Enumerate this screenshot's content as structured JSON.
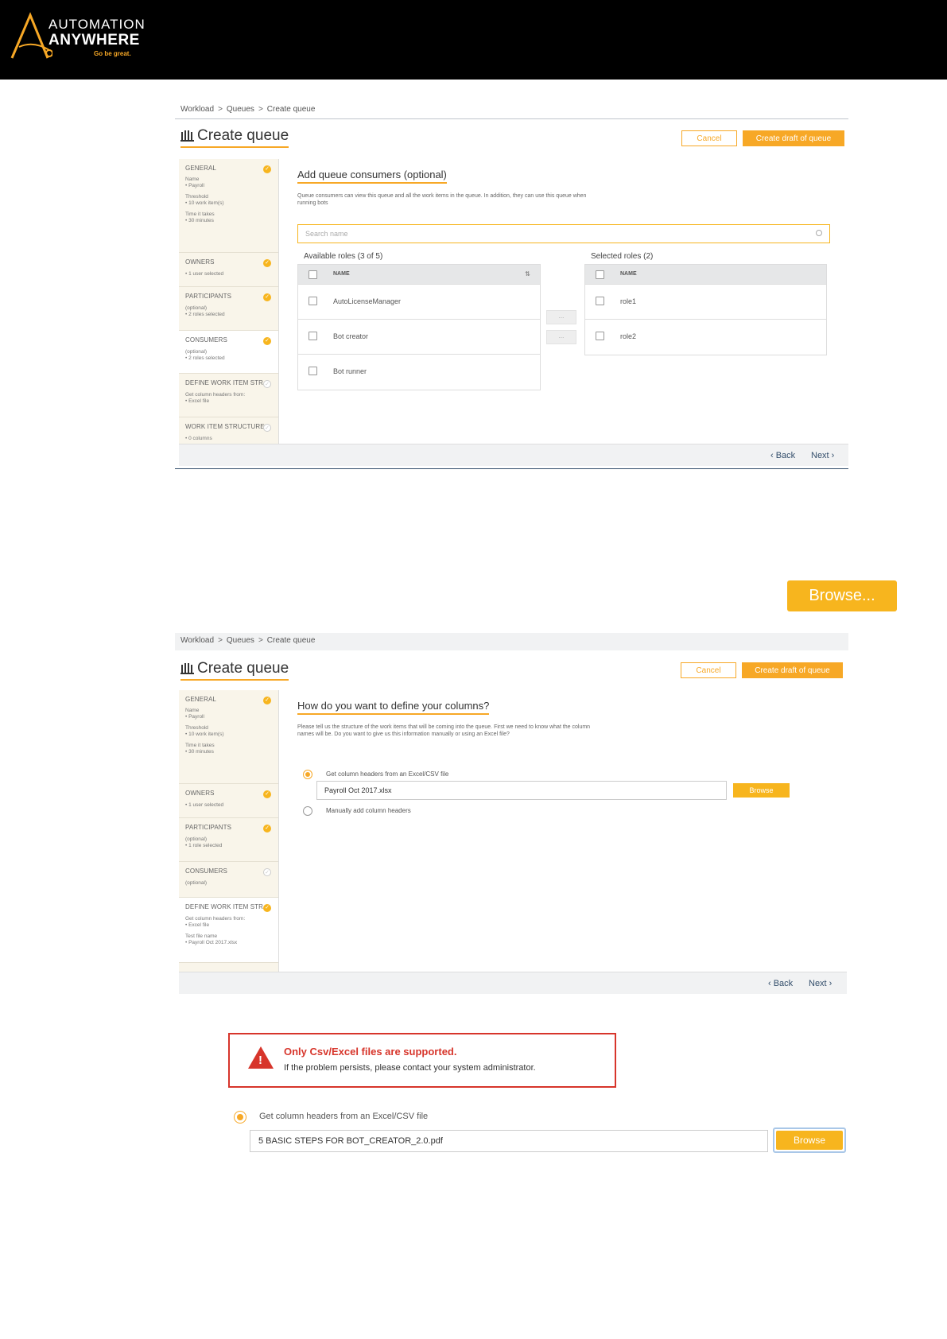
{
  "brand": {
    "line1": "AUTOMATION",
    "line2": "ANYWHERE",
    "tagline": "Go be great."
  },
  "colors": {
    "accent": "#f7a826",
    "error": "#d7352b",
    "header_bg": "#000000",
    "link": "#334e6b"
  },
  "shot1": {
    "breadcrumb": [
      "Workload",
      "Queues",
      "Create queue"
    ],
    "title": "Create queue",
    "cancel": "Cancel",
    "create_draft": "Create draft of queue",
    "sidebar": {
      "general": {
        "head": "GENERAL",
        "name_label": "Name",
        "name_value": "• Payroll",
        "threshold_label": "Threshold",
        "threshold_value": "• 10 work item(s)",
        "time_label": "Time it takes",
        "time_value": "• 30 minutes"
      },
      "owners": {
        "head": "OWNERS",
        "value": "• 1 user selected"
      },
      "participants": {
        "head": "PARTICIPANTS",
        "opt": "(optional)",
        "value": "• 2 roles selected"
      },
      "consumers": {
        "head": "CONSUMERS",
        "opt": "(optional)",
        "value": "• 2 roles selected"
      },
      "define": {
        "head": "DEFINE WORK ITEM STR...",
        "label": "Get column headers from:",
        "value": "• Excel file"
      },
      "structure": {
        "head": "WORK ITEM STRUCTURE",
        "value": "• 0 columns"
      }
    },
    "main": {
      "heading": "Add queue consumers (optional)",
      "desc": "Queue consumers can view this queue and all the work items in the queue. In addition, they can use this queue when running bots",
      "search_placeholder": "Search name",
      "available_label": "Available roles (3 of 5)",
      "selected_label": "Selected roles (2)",
      "col_name": "NAME",
      "available": [
        "AutoLicenseManager",
        "Bot creator",
        "Bot runner"
      ],
      "selected": [
        "role1",
        "role2"
      ],
      "move_right": "...",
      "move_left": "..."
    },
    "back": "‹ Back",
    "next": "Next ›"
  },
  "browse_big": "Browse...",
  "shot2": {
    "breadcrumb": [
      "Workload",
      "Queues",
      "Create queue"
    ],
    "title": "Create queue",
    "cancel": "Cancel",
    "create_draft": "Create draft of queue",
    "sidebar": {
      "general": {
        "head": "GENERAL",
        "name_label": "Name",
        "name_value": "• Payroll",
        "threshold_label": "Threshold",
        "threshold_value": "• 10 work item(s)",
        "time_label": "Time it takes",
        "time_value": "• 30 minutes"
      },
      "owners": {
        "head": "OWNERS",
        "value": "• 1 user selected"
      },
      "participants": {
        "head": "PARTICIPANTS",
        "opt": "(optional)",
        "value": "• 1 role selected"
      },
      "consumers": {
        "head": "CONSUMERS",
        "opt": "(optional)"
      },
      "define": {
        "head": "DEFINE WORK ITEM STR...",
        "label": "Get column headers from:",
        "value": "• Excel file",
        "file_label": "Test file name",
        "file_value": "• Payroll Oct 2017.xlsx"
      }
    },
    "main": {
      "heading": "How do you want to define your columns?",
      "desc": "Please tell us the structure of the work items that will be coming into the queue. First we need to know what the column names will be. Do you want to give us this information manually or using an Excel file?",
      "opt1": "Get column headers from an Excel/CSV file",
      "file_value": "Payroll Oct 2017.xlsx",
      "browse": "Browse",
      "opt2": "Manually add column headers"
    },
    "back": "‹ Back",
    "next": "Next ›"
  },
  "error": {
    "title": "Only Csv/Excel files are supported.",
    "message": "If the problem persists, please contact your system administrator."
  },
  "shot3": {
    "opt1": "Get column headers from an Excel/CSV file",
    "file_value": "5 BASIC STEPS FOR BOT_CREATOR_2.0.pdf",
    "browse": "Browse"
  }
}
